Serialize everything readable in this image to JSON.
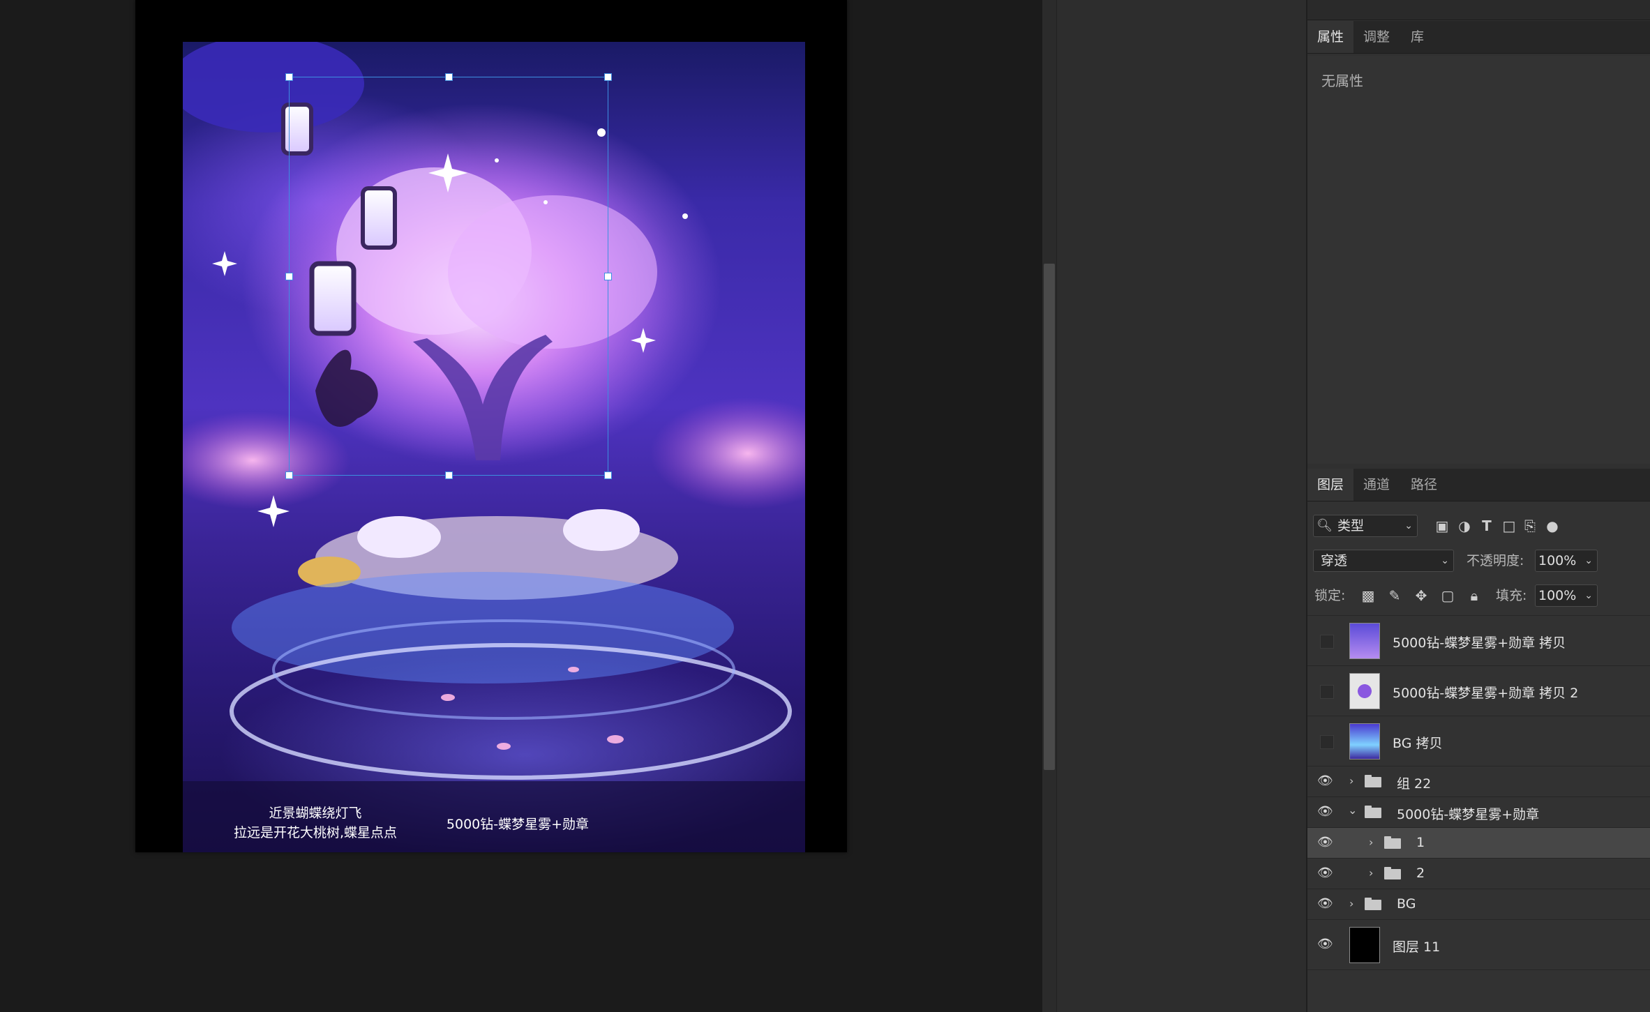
{
  "canvas": {
    "captions": {
      "left_line1": "近景蝴蝶绕灯飞",
      "left_line2": "拉远是开花大桃树,蝶星点点",
      "right": "5000钻-蝶梦星雾+勋章"
    }
  },
  "properties_panel": {
    "tabs": [
      "属性",
      "调整",
      "库"
    ],
    "empty_text": "无属性"
  },
  "layers_panel": {
    "tabs": [
      "图层",
      "通道",
      "路径"
    ],
    "filter_kind": "类型",
    "blend_mode": "穿透",
    "opacity_label": "不透明度:",
    "opacity_value": "100%",
    "lock_label": "锁定:",
    "fill_label": "填充:",
    "fill_value": "100%",
    "layers": [
      {
        "name": "5000钻-蝶梦星雾+勋章 拷贝",
        "visible": false,
        "type": "image"
      },
      {
        "name": "5000钻-蝶梦星雾+勋章 拷贝 2",
        "visible": false,
        "type": "image"
      },
      {
        "name": "BG 拷贝",
        "visible": false,
        "type": "image"
      },
      {
        "name": "组 22",
        "visible": true,
        "type": "group-collapsed"
      },
      {
        "name": "5000钻-蝶梦星雾+勋章",
        "visible": true,
        "type": "group-expanded"
      },
      {
        "name": "1",
        "visible": true,
        "type": "group-collapsed",
        "selected": true
      },
      {
        "name": "2",
        "visible": true,
        "type": "group-collapsed"
      },
      {
        "name": "BG",
        "visible": true,
        "type": "group-collapsed"
      },
      {
        "name": "图层 11",
        "visible": true,
        "type": "image-black"
      }
    ]
  },
  "icons": {
    "eye": "eye-icon",
    "search": "search-icon",
    "folder": "folder-icon",
    "lock": "lock-icon"
  }
}
